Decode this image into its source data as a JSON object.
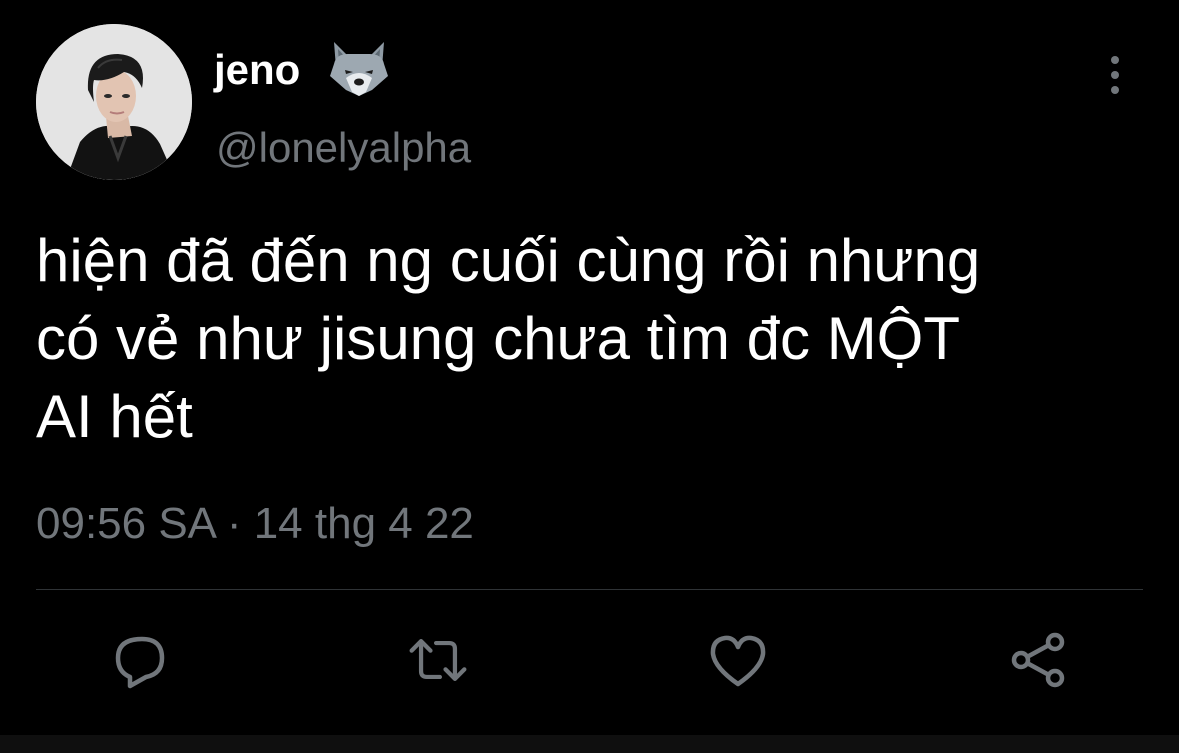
{
  "tweet": {
    "author": {
      "display_name": "jeno",
      "name_emoji_icon": "wolf-face-icon",
      "handle": "@lonelyalpha",
      "avatar_icon": "profile-photo"
    },
    "text": "hiện đã đến ng cuối cùng rồi nhưng\ncó vẻ như jisung chưa tìm đc MỘT\nAI hết",
    "timestamp": "09:56 SA · 14 thg 4 22",
    "more_icon": "more-vertical-icon"
  },
  "actions": [
    {
      "name": "reply",
      "icon": "reply-bubble-icon"
    },
    {
      "name": "retweet",
      "icon": "retweet-icon"
    },
    {
      "name": "like",
      "icon": "heart-icon"
    },
    {
      "name": "share",
      "icon": "share-icon"
    }
  ],
  "colors": {
    "background": "#000000",
    "text_primary": "#ffffff",
    "text_secondary": "#71767b",
    "divider": "#2f3336"
  }
}
